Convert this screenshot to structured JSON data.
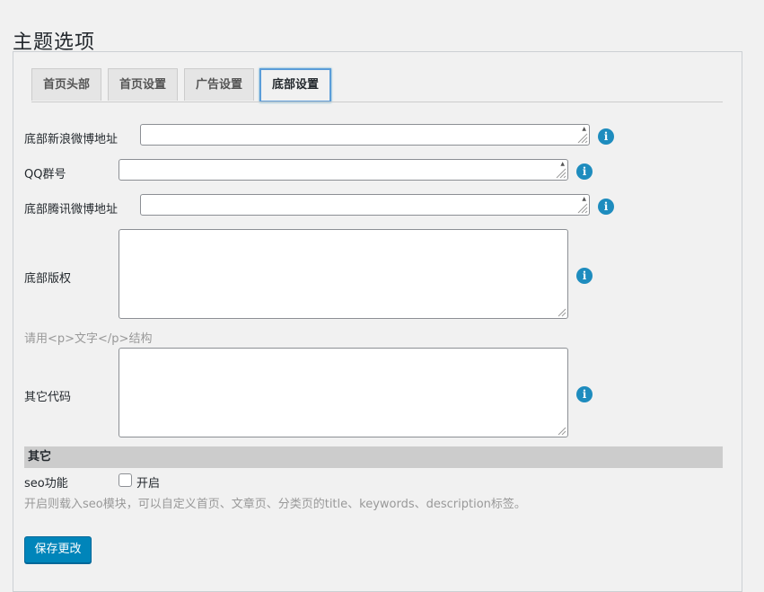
{
  "page": {
    "title": "主题选项"
  },
  "tabs": [
    {
      "label": "首页头部"
    },
    {
      "label": "首页设置"
    },
    {
      "label": "广告设置"
    },
    {
      "label": "底部设置"
    }
  ],
  "fields": {
    "weibo": {
      "label": "底部新浪微博地址",
      "value": ""
    },
    "qq": {
      "label": "QQ群号",
      "value": ""
    },
    "tencent": {
      "label": "底部腾讯微博地址",
      "value": ""
    },
    "copyright": {
      "label": "底部版权",
      "value": "",
      "hint": "请用<p>文字</p>结构"
    },
    "other_code": {
      "label": "其它代码",
      "value": ""
    }
  },
  "section": {
    "title": "其它"
  },
  "seo": {
    "label": "seo功能",
    "checkbox_label": "开启",
    "checked": false,
    "hint": "开启则载入seo模块，可以自定义首页、文章页、分类页的title、keywords、description标签。"
  },
  "actions": {
    "save_label": "保存更改"
  },
  "icons": {
    "info": "info-icon"
  },
  "colors": {
    "accent": "#0085ba",
    "info": "#1e8cbe"
  }
}
